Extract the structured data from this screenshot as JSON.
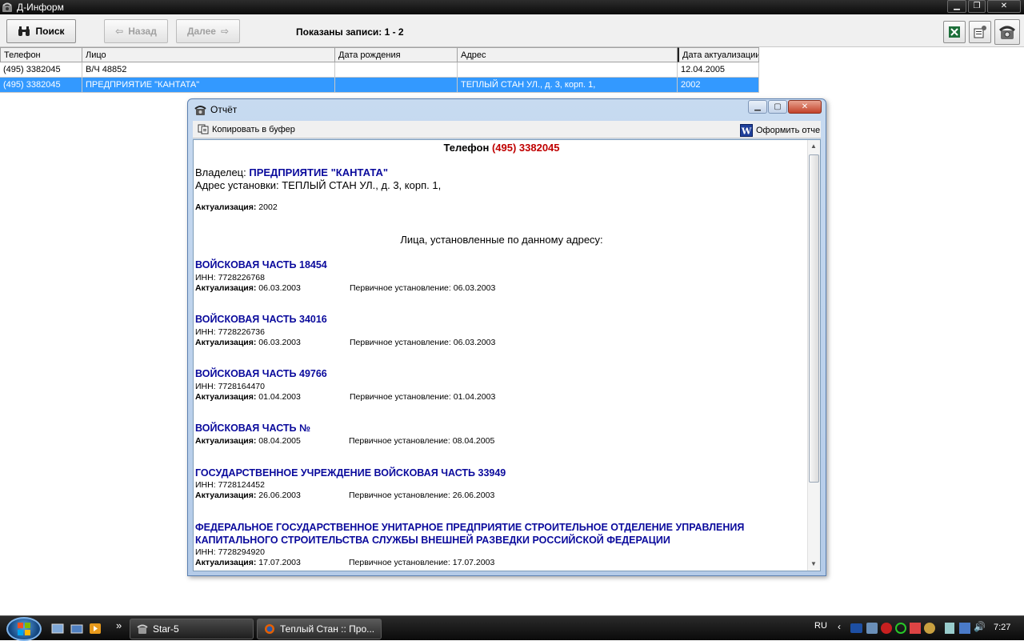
{
  "window": {
    "title": "Д-Информ",
    "minimize_icon": "minimize-icon",
    "restore_icon": "restore-icon",
    "close_icon": "close-icon"
  },
  "toolbar": {
    "search_label": "Поиск",
    "back_label": "Назад",
    "next_label": "Далее",
    "records_text": "Показаны записи: 1 - 2",
    "icons": [
      "excel-export-icon",
      "settings-icon",
      "phone-icon"
    ]
  },
  "grid": {
    "columns": [
      "Телефон",
      "Лицо",
      "Дата рождения",
      "Адрес",
      "Дата актуализации"
    ],
    "rows": [
      {
        "phone": "(495) 3382045",
        "person": "В/Ч 48852",
        "birth": "",
        "address": "",
        "updated": "12.04.2005"
      },
      {
        "phone": "(495) 3382045",
        "person": "ПРЕДПРИЯТИЕ \"КАНТАТА\"",
        "birth": "",
        "address": "ТЕПЛЫЙ СТАН УЛ., д. 3,  корп. 1,",
        "updated": "2002"
      }
    ],
    "selected_row": 1
  },
  "dialog": {
    "title": "Отчёт",
    "copy_label": "Копировать в буфер",
    "report_label": "Оформить отче",
    "doc": {
      "phone_label": "Телефон",
      "phone_value": "(495) 3382045",
      "owner_label": "Владелец:",
      "owner_value": "ПРЕДПРИЯТИЕ \"КАНТАТА\"",
      "address_label": "Адрес установки:",
      "address_value": "ТЕПЛЫЙ СТАН УЛ., д. 3,  корп. 1,",
      "update_label": "Актуализация:",
      "update_value": "2002",
      "section_title": "Лица, установленные по данному адресу:",
      "first_install_label": "Первичное установление:",
      "inn_label": "ИНН:",
      "orgs": [
        {
          "name": "ВОЙСКОВАЯ ЧАСТЬ 18454",
          "inn": "7728226768",
          "updated": "06.03.2003",
          "first": "06.03.2003"
        },
        {
          "name": "ВОЙСКОВАЯ ЧАСТЬ 34016",
          "inn": "7728226736",
          "updated": "06.03.2003",
          "first": "06.03.2003"
        },
        {
          "name": "ВОЙСКОВАЯ ЧАСТЬ 49766",
          "inn": "7728164470",
          "updated": "01.04.2003",
          "first": "01.04.2003"
        },
        {
          "name": "ВОЙСКОВАЯ ЧАСТЬ №",
          "inn": "",
          "updated": "08.04.2005",
          "first": "08.04.2005"
        },
        {
          "name": "ГОСУДАРСТВЕННОЕ УЧРЕЖДЕНИЕ ВОЙСКОВАЯ ЧАСТЬ 33949",
          "inn": "7728124452",
          "updated": "26.06.2003",
          "first": "26.06.2003"
        },
        {
          "name": "ФЕДЕРАЛЬНОЕ ГОСУДАРСТВЕННОЕ УНИТАРНОЕ ПРЕДПРИЯТИЕ СТРОИТЕЛЬНОЕ ОТДЕЛЕНИЕ УПРАВЛЕНИЯ",
          "name2": "КАПИТАЛЬНОГО СТРОИТЕЛЬСТВА СЛУЖБЫ ВНЕШНЕЙ РАЗВЕДКИ РОССИЙСКОЙ ФЕДЕРАЦИИ",
          "inn": "7728294920",
          "updated": "17.07.2003",
          "first": "17.07.2003"
        }
      ]
    }
  },
  "taskbar": {
    "quicklaunch_more": "»",
    "tasks": [
      "Star-5",
      "Теплый Стан :: Про..."
    ],
    "lang": "RU",
    "time": "7:27"
  },
  "colors": {
    "selection": "#3399ff",
    "org_blue": "#0a0a9c",
    "phone_red": "#c00000"
  }
}
